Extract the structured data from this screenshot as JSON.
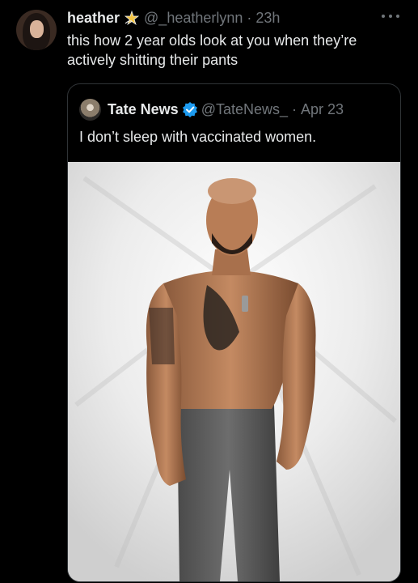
{
  "tweet": {
    "author_name": "heather",
    "author_handle": "@_heatherlynn",
    "separator": "·",
    "time": "23h",
    "text": "this how 2 year olds look at you when they’re actively shitting their pants"
  },
  "quote": {
    "author_name": "Tate News",
    "author_handle": "@TateNews_",
    "separator": "·",
    "time": "Apr 23",
    "text": "I don’t sleep with vaccinated women."
  },
  "icons": {
    "more": "more-options-icon",
    "badge_emoji": "star-emoji-icon",
    "verified": "verified-badge-icon"
  },
  "colors": {
    "background": "#000000",
    "text_primary": "#e7e9ea",
    "text_secondary": "#71767b",
    "border": "#2f3336",
    "verified_blue": "#1d9bf0"
  }
}
